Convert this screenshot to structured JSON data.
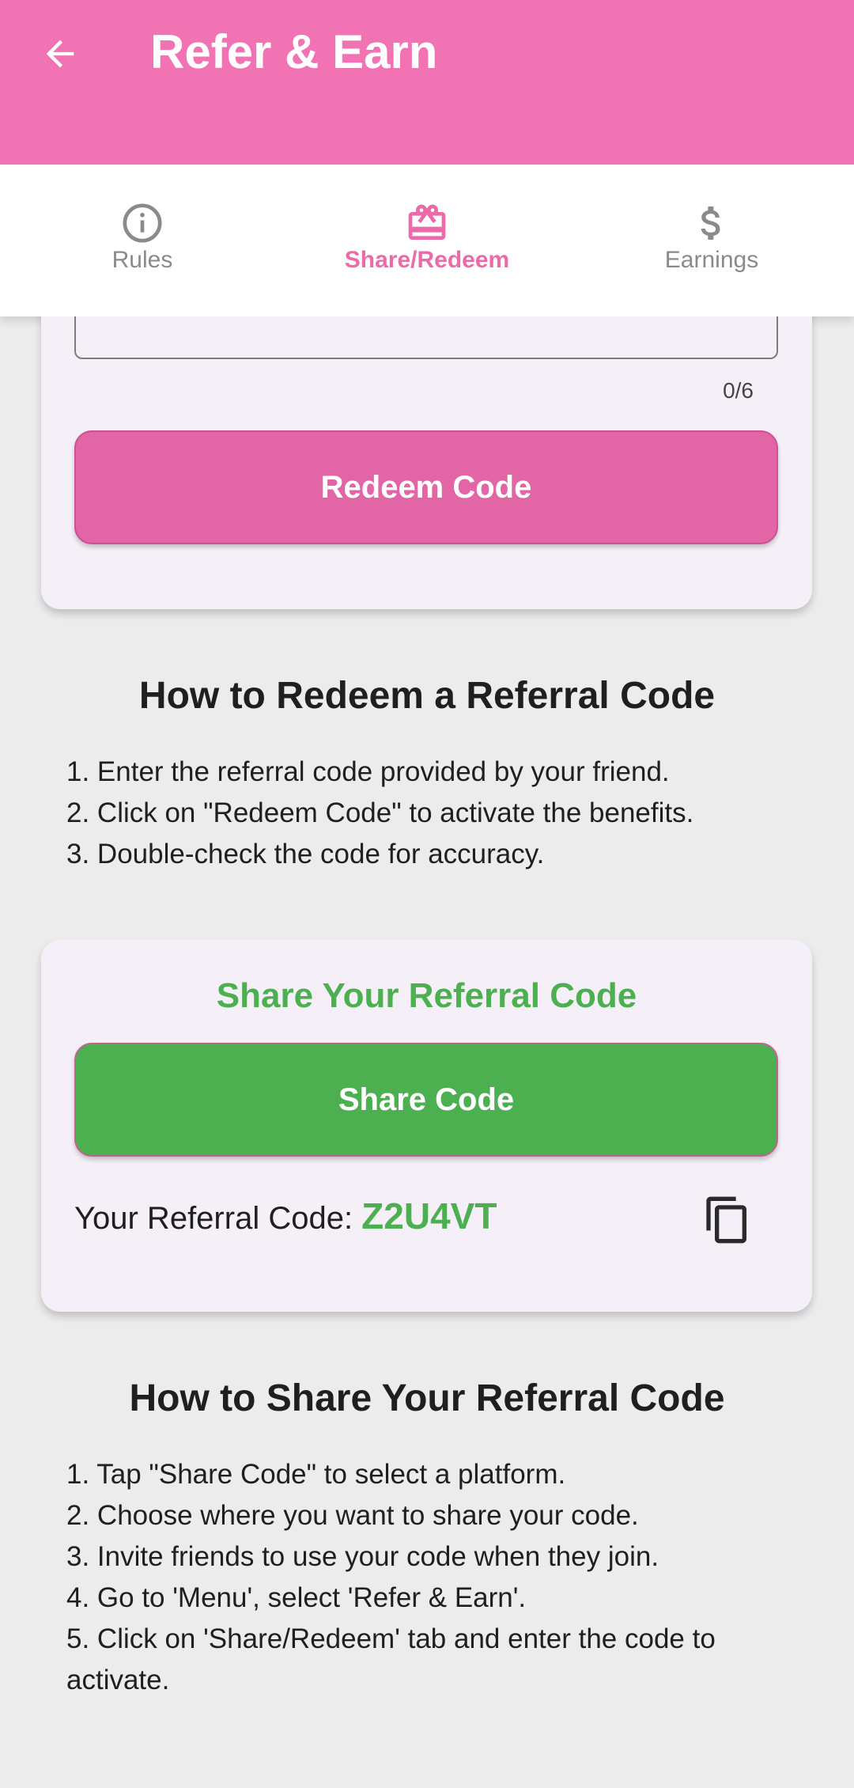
{
  "app_bar": {
    "title": "Refer & Earn",
    "back_icon": "arrow-back-icon",
    "color": "#f173b4"
  },
  "tabs": [
    {
      "label": "Rules",
      "icon": "info-icon",
      "active": false
    },
    {
      "label": "Share/Redeem",
      "icon": "gift-icon",
      "active": true
    },
    {
      "label": "Earnings",
      "icon": "dollar-icon",
      "active": false
    }
  ],
  "redeem_card": {
    "input_value": "",
    "counter": "0/6",
    "button_label": "Redeem Code",
    "button_color": "#e265a6"
  },
  "redeem_help": {
    "title": "How to Redeem a Referral Code",
    "steps": [
      "1. Enter the referral code provided by your friend.",
      "2. Click on \"Redeem Code\" to activate the benefits.",
      "3. Double-check the code for accuracy."
    ]
  },
  "share_card": {
    "title": "Share Your Referral Code",
    "button_label": "Share Code",
    "code_label": "Your Referral Code: ",
    "code_value": "Z2U4VT",
    "copy_icon": "copy-icon",
    "accent_color": "#4caf50"
  },
  "share_help": {
    "title": "How to Share Your Referral Code",
    "steps": [
      "1. Tap \"Share Code\" to select a platform.",
      "2. Choose where you want to share your code.",
      "3. Invite friends to use your code when they join.",
      "4. Go to 'Menu', select 'Refer & Earn'.",
      "5. Click on 'Share/Redeem' tab and enter the code to activate."
    ]
  }
}
